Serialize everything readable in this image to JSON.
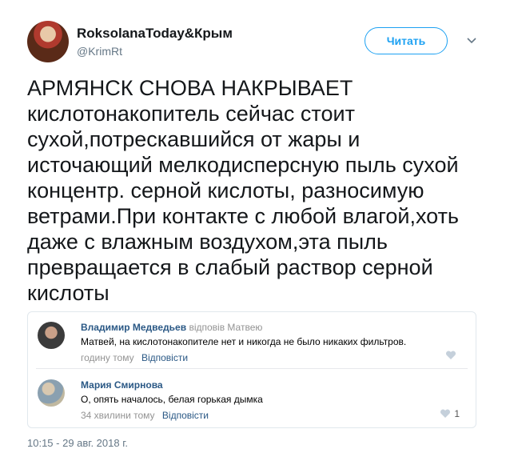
{
  "tweet": {
    "author_name": "RoksolanaToday&Крым",
    "author_handle": "@KrimRt",
    "follow_label": "Читать",
    "text": "АРМЯНСК СНОВА НАКРЫВАЕТ\nкислотонакопитель сейчас стоит\nсухой,потрескавшийся от жары и\nисточающий мелкодисперсную пыль сухой\nконцентр. серной кислоты, разносимую\nветрами.При контакте с любой влагой,хоть\nдаже с влажным воздухом,эта пыль\nпревращается в слабый раствор серной\nкислоты",
    "timestamp": "10:15 - 29 авг. 2018 г."
  },
  "comments": [
    {
      "author": "Владимир Медведьев",
      "replied_to": "відповів Матвею",
      "text": "Матвей, на кислотонакопителе нет и никогда не было никаких фильтров.",
      "time": "годину тому",
      "reply_label": "Відповісти",
      "likes": ""
    },
    {
      "author": "Мария Смирнова",
      "replied_to": "",
      "text": "О, опять началось, белая горькая дымка",
      "time": "34 хвилини тому",
      "reply_label": "Відповісти",
      "likes": "1"
    }
  ],
  "colors": {
    "accent": "#1da1f2",
    "link": "#2a5885",
    "muted": "#657786"
  },
  "icons": {
    "caret": "chevron-down-icon",
    "like": "heart-icon"
  }
}
